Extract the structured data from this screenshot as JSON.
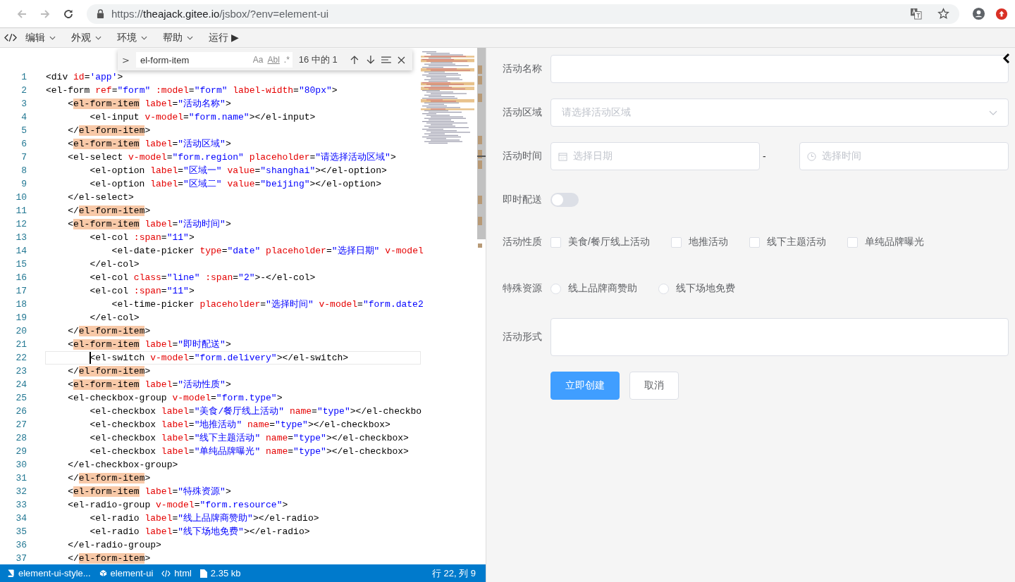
{
  "browser": {
    "url": {
      "scheme": "https://",
      "host": "theajack.gitee.io",
      "path": "/jsbox/?env=element-ui"
    }
  },
  "menu": {
    "items": [
      {
        "label": "编辑",
        "kind": "dropdown"
      },
      {
        "label": "外观",
        "kind": "dropdown"
      },
      {
        "label": "环境",
        "kind": "dropdown"
      },
      {
        "label": "帮助",
        "kind": "dropdown"
      },
      {
        "label": "运行 ▶",
        "kind": "action"
      }
    ]
  },
  "find": {
    "toggle": ">",
    "query": "el-form-item",
    "options": [
      "Aa",
      "Abl",
      ".*"
    ],
    "count": "16 中的 1"
  },
  "editor": {
    "lines": [
      {
        "number": "1",
        "current": false,
        "tokens": [
          {
            "kind": "plain",
            "text": "<div "
          },
          {
            "kind": "attr",
            "text": "id"
          },
          {
            "kind": "plain",
            "text": "="
          },
          {
            "kind": "string",
            "text": "'app'"
          },
          {
            "kind": "plain",
            "text": ">"
          }
        ]
      },
      {
        "number": "2",
        "current": false,
        "tokens": [
          {
            "kind": "plain",
            "text": "<el-form "
          },
          {
            "kind": "attr",
            "text": "ref"
          },
          {
            "kind": "plain",
            "text": "="
          },
          {
            "kind": "string",
            "text": "\"form\" "
          },
          {
            "kind": "attr",
            "text": ":model"
          },
          {
            "kind": "plain",
            "text": "="
          },
          {
            "kind": "string",
            "text": "\"form\" "
          },
          {
            "kind": "attr",
            "text": "label-width"
          },
          {
            "kind": "plain",
            "text": "="
          },
          {
            "kind": "string",
            "text": "\"80px\""
          },
          {
            "kind": "plain",
            "text": ">"
          }
        ]
      },
      {
        "number": "3",
        "current": false,
        "tokens": [
          {
            "kind": "plain",
            "text": "    <"
          },
          {
            "kind": "match",
            "text": "el-form-item"
          },
          {
            "kind": "attr",
            "text": " label"
          },
          {
            "kind": "plain",
            "text": "="
          },
          {
            "kind": "string",
            "text": "\"活动名称\""
          },
          {
            "kind": "plain",
            "text": ">"
          }
        ]
      },
      {
        "number": "4",
        "current": false,
        "tokens": [
          {
            "kind": "plain",
            "text": "        <el-input "
          },
          {
            "kind": "attr",
            "text": "v-model"
          },
          {
            "kind": "plain",
            "text": "="
          },
          {
            "kind": "string",
            "text": "\"form.name\""
          },
          {
            "kind": "plain",
            "text": "></el-input>"
          }
        ]
      },
      {
        "number": "5",
        "current": false,
        "tokens": [
          {
            "kind": "plain",
            "text": "    </"
          },
          {
            "kind": "match",
            "text": "el-form-item"
          },
          {
            "kind": "plain",
            "text": ">"
          }
        ]
      },
      {
        "number": "6",
        "current": false,
        "tokens": [
          {
            "kind": "plain",
            "text": "    <"
          },
          {
            "kind": "match",
            "text": "el-form-item"
          },
          {
            "kind": "attr",
            "text": " label"
          },
          {
            "kind": "plain",
            "text": "="
          },
          {
            "kind": "string",
            "text": "\"活动区域\""
          },
          {
            "kind": "plain",
            "text": ">"
          }
        ]
      },
      {
        "number": "7",
        "current": false,
        "tokens": [
          {
            "kind": "plain",
            "text": "    <el-select "
          },
          {
            "kind": "attr",
            "text": "v-model"
          },
          {
            "kind": "plain",
            "text": "="
          },
          {
            "kind": "string",
            "text": "\"form.region\" "
          },
          {
            "kind": "attr",
            "text": "placeholder"
          },
          {
            "kind": "plain",
            "text": "="
          },
          {
            "kind": "string",
            "text": "\"请选择活动区域\""
          },
          {
            "kind": "plain",
            "text": ">"
          }
        ]
      },
      {
        "number": "8",
        "current": false,
        "tokens": [
          {
            "kind": "plain",
            "text": "        <el-option "
          },
          {
            "kind": "attr",
            "text": "label"
          },
          {
            "kind": "plain",
            "text": "="
          },
          {
            "kind": "string",
            "text": "\"区域一\" "
          },
          {
            "kind": "attr",
            "text": "value"
          },
          {
            "kind": "plain",
            "text": "="
          },
          {
            "kind": "string",
            "text": "\"shanghai\""
          },
          {
            "kind": "plain",
            "text": "></el-option>"
          }
        ]
      },
      {
        "number": "9",
        "current": false,
        "tokens": [
          {
            "kind": "plain",
            "text": "        <el-option "
          },
          {
            "kind": "attr",
            "text": "label"
          },
          {
            "kind": "plain",
            "text": "="
          },
          {
            "kind": "string",
            "text": "\"区域二\" "
          },
          {
            "kind": "attr",
            "text": "value"
          },
          {
            "kind": "plain",
            "text": "="
          },
          {
            "kind": "string",
            "text": "\"beijing\""
          },
          {
            "kind": "plain",
            "text": "></el-option>"
          }
        ]
      },
      {
        "number": "10",
        "current": false,
        "tokens": [
          {
            "kind": "plain",
            "text": "    </el-select>"
          }
        ]
      },
      {
        "number": "11",
        "current": false,
        "tokens": [
          {
            "kind": "plain",
            "text": "    </"
          },
          {
            "kind": "match",
            "text": "el-form-item"
          },
          {
            "kind": "plain",
            "text": ">"
          }
        ]
      },
      {
        "number": "12",
        "current": false,
        "tokens": [
          {
            "kind": "plain",
            "text": "    <"
          },
          {
            "kind": "match",
            "text": "el-form-item"
          },
          {
            "kind": "attr",
            "text": " label"
          },
          {
            "kind": "plain",
            "text": "="
          },
          {
            "kind": "string",
            "text": "\"活动时间\""
          },
          {
            "kind": "plain",
            "text": ">"
          }
        ]
      },
      {
        "number": "13",
        "current": false,
        "tokens": [
          {
            "kind": "plain",
            "text": "        <el-col "
          },
          {
            "kind": "attr",
            "text": ":span"
          },
          {
            "kind": "plain",
            "text": "="
          },
          {
            "kind": "string",
            "text": "\"11\""
          },
          {
            "kind": "plain",
            "text": ">"
          }
        ]
      },
      {
        "number": "14",
        "current": false,
        "tokens": [
          {
            "kind": "plain",
            "text": "            <el-date-picker "
          },
          {
            "kind": "attr",
            "text": "type"
          },
          {
            "kind": "plain",
            "text": "="
          },
          {
            "kind": "string",
            "text": "\"date\" "
          },
          {
            "kind": "attr",
            "text": "placeholder"
          },
          {
            "kind": "plain",
            "text": "="
          },
          {
            "kind": "string",
            "text": "\"选择日期\" "
          },
          {
            "kind": "attr",
            "text": "v-model"
          }
        ]
      },
      {
        "number": "15",
        "current": false,
        "tokens": [
          {
            "kind": "plain",
            "text": "        </el-col>"
          }
        ]
      },
      {
        "number": "16",
        "current": false,
        "tokens": [
          {
            "kind": "plain",
            "text": "        <el-col "
          },
          {
            "kind": "attr",
            "text": "class"
          },
          {
            "kind": "plain",
            "text": "="
          },
          {
            "kind": "string",
            "text": "\"line\" "
          },
          {
            "kind": "attr",
            "text": ":span"
          },
          {
            "kind": "plain",
            "text": "="
          },
          {
            "kind": "string",
            "text": "\"2\""
          },
          {
            "kind": "plain",
            "text": ">-</el-col>"
          }
        ]
      },
      {
        "number": "17",
        "current": false,
        "tokens": [
          {
            "kind": "plain",
            "text": "        <el-col "
          },
          {
            "kind": "attr",
            "text": ":span"
          },
          {
            "kind": "plain",
            "text": "="
          },
          {
            "kind": "string",
            "text": "\"11\""
          },
          {
            "kind": "plain",
            "text": ">"
          }
        ]
      },
      {
        "number": "18",
        "current": false,
        "tokens": [
          {
            "kind": "plain",
            "text": "            <el-time-picker "
          },
          {
            "kind": "attr",
            "text": "placeholder"
          },
          {
            "kind": "plain",
            "text": "="
          },
          {
            "kind": "string",
            "text": "\"选择时间\" "
          },
          {
            "kind": "attr",
            "text": "v-model"
          },
          {
            "kind": "plain",
            "text": "="
          },
          {
            "kind": "string",
            "text": "\"form.date2"
          }
        ]
      },
      {
        "number": "19",
        "current": false,
        "tokens": [
          {
            "kind": "plain",
            "text": "        </el-col>"
          }
        ]
      },
      {
        "number": "20",
        "current": false,
        "tokens": [
          {
            "kind": "plain",
            "text": "    </"
          },
          {
            "kind": "match",
            "text": "el-form-item"
          },
          {
            "kind": "plain",
            "text": ">"
          }
        ]
      },
      {
        "number": "21",
        "current": false,
        "tokens": [
          {
            "kind": "plain",
            "text": "    <"
          },
          {
            "kind": "match",
            "text": "el-form-item"
          },
          {
            "kind": "attr",
            "text": " label"
          },
          {
            "kind": "plain",
            "text": "="
          },
          {
            "kind": "string",
            "text": "\"即时配送\""
          },
          {
            "kind": "plain",
            "text": ">"
          }
        ]
      },
      {
        "number": "22",
        "current": true,
        "tokens": [
          {
            "kind": "plain",
            "text": "        <el-switch "
          },
          {
            "kind": "attr",
            "text": "v-model"
          },
          {
            "kind": "plain",
            "text": "="
          },
          {
            "kind": "string",
            "text": "\"form.delivery\""
          },
          {
            "kind": "plain",
            "text": "></el-switch>"
          }
        ]
      },
      {
        "number": "23",
        "current": false,
        "tokens": [
          {
            "kind": "plain",
            "text": "    </"
          },
          {
            "kind": "match",
            "text": "el-form-item"
          },
          {
            "kind": "plain",
            "text": ">"
          }
        ]
      },
      {
        "number": "24",
        "current": false,
        "tokens": [
          {
            "kind": "plain",
            "text": "    <"
          },
          {
            "kind": "match",
            "text": "el-form-item"
          },
          {
            "kind": "attr",
            "text": " label"
          },
          {
            "kind": "plain",
            "text": "="
          },
          {
            "kind": "string",
            "text": "\"活动性质\""
          },
          {
            "kind": "plain",
            "text": ">"
          }
        ]
      },
      {
        "number": "25",
        "current": false,
        "tokens": [
          {
            "kind": "plain",
            "text": "    <el-checkbox-group "
          },
          {
            "kind": "attr",
            "text": "v-model"
          },
          {
            "kind": "plain",
            "text": "="
          },
          {
            "kind": "string",
            "text": "\"form.type\""
          },
          {
            "kind": "plain",
            "text": ">"
          }
        ]
      },
      {
        "number": "26",
        "current": false,
        "tokens": [
          {
            "kind": "plain",
            "text": "        <el-checkbox "
          },
          {
            "kind": "attr",
            "text": "label"
          },
          {
            "kind": "plain",
            "text": "="
          },
          {
            "kind": "string",
            "text": "\"美食/餐厅线上活动\" "
          },
          {
            "kind": "attr",
            "text": "name"
          },
          {
            "kind": "plain",
            "text": "="
          },
          {
            "kind": "string",
            "text": "\"type\""
          },
          {
            "kind": "plain",
            "text": "></el-checkbo"
          }
        ]
      },
      {
        "number": "27",
        "current": false,
        "tokens": [
          {
            "kind": "plain",
            "text": "        <el-checkbox "
          },
          {
            "kind": "attr",
            "text": "label"
          },
          {
            "kind": "plain",
            "text": "="
          },
          {
            "kind": "string",
            "text": "\"地推活动\" "
          },
          {
            "kind": "attr",
            "text": "name"
          },
          {
            "kind": "plain",
            "text": "="
          },
          {
            "kind": "string",
            "text": "\"type\""
          },
          {
            "kind": "plain",
            "text": "></el-checkbox>"
          }
        ]
      },
      {
        "number": "28",
        "current": false,
        "tokens": [
          {
            "kind": "plain",
            "text": "        <el-checkbox "
          },
          {
            "kind": "attr",
            "text": "label"
          },
          {
            "kind": "plain",
            "text": "="
          },
          {
            "kind": "string",
            "text": "\"线下主题活动\" "
          },
          {
            "kind": "attr",
            "text": "name"
          },
          {
            "kind": "plain",
            "text": "="
          },
          {
            "kind": "string",
            "text": "\"type\""
          },
          {
            "kind": "plain",
            "text": "></el-checkbox>"
          }
        ]
      },
      {
        "number": "29",
        "current": false,
        "tokens": [
          {
            "kind": "plain",
            "text": "        <el-checkbox "
          },
          {
            "kind": "attr",
            "text": "label"
          },
          {
            "kind": "plain",
            "text": "="
          },
          {
            "kind": "string",
            "text": "\"单纯品牌曝光\" "
          },
          {
            "kind": "attr",
            "text": "name"
          },
          {
            "kind": "plain",
            "text": "="
          },
          {
            "kind": "string",
            "text": "\"type\""
          },
          {
            "kind": "plain",
            "text": "></el-checkbox>"
          }
        ]
      },
      {
        "number": "30",
        "current": false,
        "tokens": [
          {
            "kind": "plain",
            "text": "    </el-checkbox-group>"
          }
        ]
      },
      {
        "number": "31",
        "current": false,
        "tokens": [
          {
            "kind": "plain",
            "text": "    </"
          },
          {
            "kind": "match",
            "text": "el-form-item"
          },
          {
            "kind": "plain",
            "text": ">"
          }
        ]
      },
      {
        "number": "32",
        "current": false,
        "tokens": [
          {
            "kind": "plain",
            "text": "    <"
          },
          {
            "kind": "match",
            "text": "el-form-item"
          },
          {
            "kind": "attr",
            "text": " label"
          },
          {
            "kind": "plain",
            "text": "="
          },
          {
            "kind": "string",
            "text": "\"特殊资源\""
          },
          {
            "kind": "plain",
            "text": ">"
          }
        ]
      },
      {
        "number": "33",
        "current": false,
        "tokens": [
          {
            "kind": "plain",
            "text": "    <el-radio-group "
          },
          {
            "kind": "attr",
            "text": "v-model"
          },
          {
            "kind": "plain",
            "text": "="
          },
          {
            "kind": "string",
            "text": "\"form.resource\""
          },
          {
            "kind": "plain",
            "text": ">"
          }
        ]
      },
      {
        "number": "34",
        "current": false,
        "tokens": [
          {
            "kind": "plain",
            "text": "        <el-radio "
          },
          {
            "kind": "attr",
            "text": "label"
          },
          {
            "kind": "plain",
            "text": "="
          },
          {
            "kind": "string",
            "text": "\"线上品牌商赞助\""
          },
          {
            "kind": "plain",
            "text": "></el-radio>"
          }
        ]
      },
      {
        "number": "35",
        "current": false,
        "tokens": [
          {
            "kind": "plain",
            "text": "        <el-radio "
          },
          {
            "kind": "attr",
            "text": "label"
          },
          {
            "kind": "plain",
            "text": "="
          },
          {
            "kind": "string",
            "text": "\"线下场地免费\""
          },
          {
            "kind": "plain",
            "text": "></el-radio>"
          }
        ]
      },
      {
        "number": "36",
        "current": false,
        "tokens": [
          {
            "kind": "plain",
            "text": "    </el-radio-group>"
          }
        ]
      },
      {
        "number": "37",
        "current": false,
        "tokens": [
          {
            "kind": "plain",
            "text": "    </"
          },
          {
            "kind": "match",
            "text": "el-form-item"
          },
          {
            "kind": "plain",
            "text": ">"
          }
        ]
      }
    ]
  },
  "status_bar": {
    "items": [
      {
        "kind": "book",
        "label": "element-ui-style..."
      },
      {
        "kind": "cube",
        "label": "element-ui"
      },
      {
        "kind": "code",
        "label": "html"
      },
      {
        "kind": "file",
        "label": "2.35 kb"
      }
    ],
    "position": "行 22, 列 9"
  },
  "form": {
    "fields": [
      {
        "kind": "input",
        "label": "活动名称"
      },
      {
        "kind": "select",
        "label": "活动区域",
        "placeholder": "请选择活动区域"
      },
      {
        "kind": "datetime",
        "label": "活动时间",
        "date_placeholder": "选择日期",
        "separator": "-",
        "time_placeholder": "选择时间"
      },
      {
        "kind": "switch",
        "label": "即时配送",
        "on": false
      },
      {
        "kind": "checkbox",
        "label": "活动性质",
        "options": [
          {
            "label": "美食/餐厅线上活动",
            "checked": false
          },
          {
            "label": "地推活动",
            "checked": false
          },
          {
            "label": "线下主题活动",
            "checked": false
          },
          {
            "label": "单纯品牌曝光",
            "checked": false
          }
        ]
      },
      {
        "kind": "radio",
        "label": "特殊资源",
        "options": [
          {
            "label": "线上品牌商赞助",
            "selected": false
          },
          {
            "label": "线下场地免费",
            "selected": false
          }
        ]
      },
      {
        "kind": "textarea",
        "label": "活动形式"
      }
    ],
    "buttons": [
      {
        "label": "立即创建",
        "kind": "primary"
      },
      {
        "label": "取消",
        "kind": "default"
      }
    ]
  }
}
